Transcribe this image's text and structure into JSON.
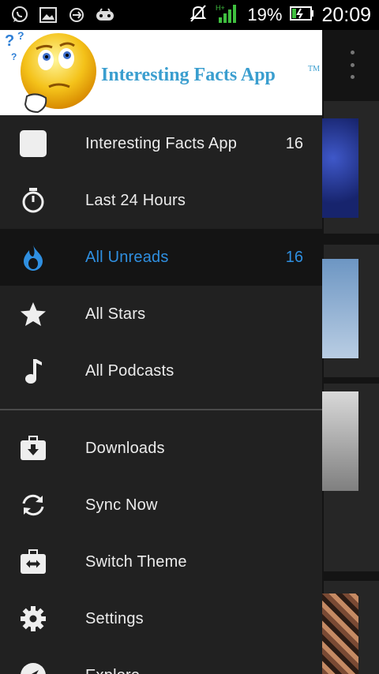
{
  "status_bar": {
    "battery_percent": "19%",
    "time": "20:09",
    "network": "H+",
    "notification_icons": [
      "whatsapp-icon",
      "gallery-icon",
      "sync-app-icon",
      "gamepad-icon"
    ]
  },
  "drawer": {
    "header": {
      "title": "Interesting Facts App",
      "trademark": "TM"
    },
    "items": [
      {
        "label": "Interesting Facts App",
        "count": "16",
        "icon": "feed-square-icon"
      },
      {
        "label": "Last 24 Hours",
        "count": "",
        "icon": "stopwatch-icon"
      },
      {
        "label": "All Unreads",
        "count": "16",
        "icon": "flame-icon",
        "active": true
      },
      {
        "label": "All Stars",
        "count": "",
        "icon": "star-icon"
      },
      {
        "label": "All Podcasts",
        "count": "",
        "icon": "music-note-icon"
      }
    ],
    "secondary_items": [
      {
        "label": "Downloads",
        "icon": "download-icon"
      },
      {
        "label": "Sync Now",
        "icon": "sync-icon"
      },
      {
        "label": "Switch Theme",
        "icon": "switch-theme-icon"
      },
      {
        "label": "Settings",
        "icon": "gear-icon"
      },
      {
        "label": "Explore",
        "icon": "compass-icon"
      }
    ]
  },
  "colors": {
    "accent": "#2f8fe0",
    "drawer_bg": "#212121",
    "active_bg": "#141414",
    "header_text": "#3a9ecf"
  }
}
